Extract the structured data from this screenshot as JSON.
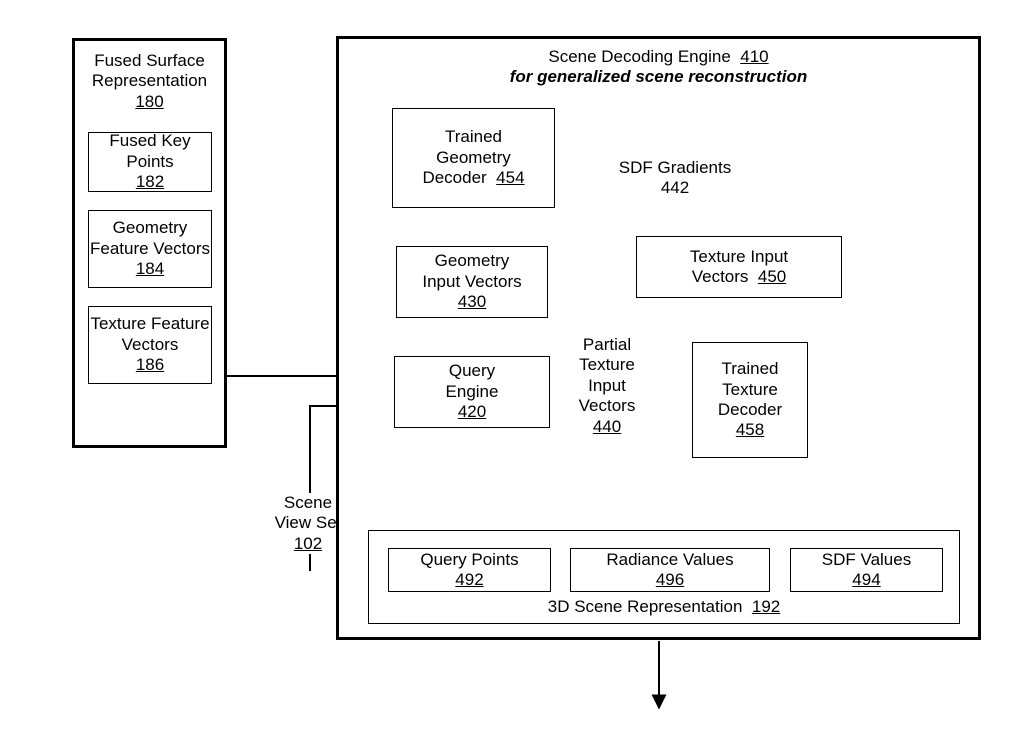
{
  "left_panel": {
    "title": "Fused Surface Representation",
    "title_ref": "180",
    "items": [
      {
        "label": "Fused Key Points",
        "ref": "182"
      },
      {
        "label": "Geometry Feature Vectors",
        "ref": "184"
      },
      {
        "label": "Texture Feature Vectors",
        "ref": "186"
      }
    ]
  },
  "engine": {
    "title": "Scene Decoding Engine",
    "title_ref": "410",
    "subtitle": "for generalized scene reconstruction",
    "geom_decoder": {
      "line1": "Trained",
      "line2": "Geometry",
      "line3": "Decoder",
      "ref": "454"
    },
    "geom_input": {
      "line1": "Geometry",
      "line2": "Input Vectors",
      "ref": "430"
    },
    "query": {
      "line1": "Query",
      "line2": "Engine",
      "ref": "420"
    },
    "sdf_grad": {
      "line1": "SDF Gradients",
      "ref": "442"
    },
    "tex_input": {
      "line1": "Texture Input",
      "line2": "Vectors",
      "ref": "450"
    },
    "partial": {
      "line1": "Partial",
      "line2": "Texture",
      "line3": "Input",
      "line4": "Vectors",
      "ref": "440"
    },
    "tex_decoder": {
      "line1": "Trained",
      "line2": "Texture",
      "line3": "Decoder",
      "ref": "458"
    },
    "scene_rep": {
      "title": "3D Scene Representation",
      "ref": "192",
      "qpoints": {
        "label": "Query Points",
        "ref": "492"
      },
      "radiance": {
        "label": "Radiance Values",
        "ref": "496"
      },
      "sdfvals": {
        "label": "SDF Values",
        "ref": "494"
      }
    }
  },
  "scene_view": {
    "line1": "Scene",
    "line2": "View Set",
    "ref": "102"
  }
}
